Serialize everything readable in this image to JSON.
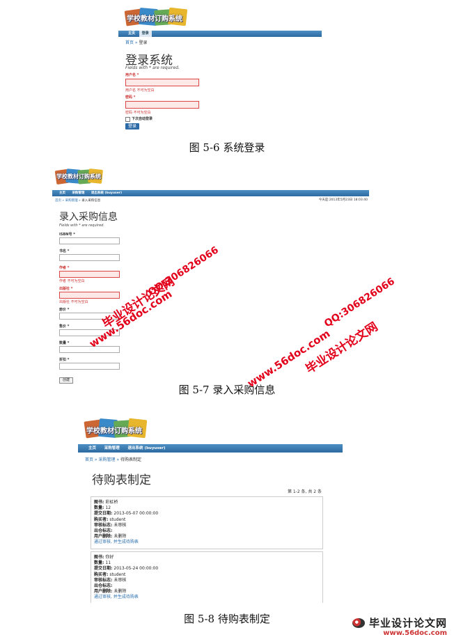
{
  "app_logo": "学校教材订购系统",
  "fig1": {
    "nav": [
      "主页",
      "登录"
    ],
    "breadcrumb": [
      "首页",
      "登录"
    ],
    "title": "登录系统",
    "required_note": "Fields with * are required.",
    "username_label": "用户名 *",
    "username_error": "用户名 不可为空白",
    "password_label": "密码 *",
    "password_error": "密码 不可为空白",
    "remember_label": "下次自动登录",
    "submit_label": "登录",
    "caption": "图 5-6 系统登录"
  },
  "fig2": {
    "nav": [
      "主页",
      "采购管理",
      "退出系统 (buyuser)"
    ],
    "breadcrumb": [
      "首页",
      "采购管理",
      "录入采购信息"
    ],
    "datetime": "今天是:2013年5月23日 18:03:40",
    "title": "录入采购信息",
    "required_note": "Fields with * are required.",
    "fields": [
      {
        "label": "ISBN号 *",
        "error": false,
        "msg": ""
      },
      {
        "label": "书名 *",
        "error": false,
        "msg": ""
      },
      {
        "label": "作者 *",
        "error": true,
        "msg": "作者 不可为空白"
      },
      {
        "label": "出版社 *",
        "error": true,
        "msg": "出版社 不可为空白"
      },
      {
        "label": "册价 *",
        "error": false,
        "msg": ""
      },
      {
        "label": "售价 *",
        "error": false,
        "msg": ""
      },
      {
        "label": "数量 *",
        "error": false,
        "msg": ""
      },
      {
        "label": "折扣 *",
        "error": false,
        "msg": ""
      }
    ],
    "submit_label": "创建",
    "caption": "图 5-7 录入采购信息"
  },
  "fig3": {
    "nav": [
      "主页",
      "采购管理",
      "退出系统 (buyuser)"
    ],
    "breadcrumb": [
      "首页",
      "采购管理",
      "待购表制定"
    ],
    "title": "待购表制定",
    "summary": "第 1-2 条, 共 2 条",
    "cards": [
      {
        "rows": [
          {
            "k": "图书:",
            "v": "彩虹桥"
          },
          {
            "k": "数量:",
            "v": "12"
          },
          {
            "k": "提交日期:",
            "v": "2013-05-07 00:00:00"
          },
          {
            "k": "购买者:",
            "v": "student"
          },
          {
            "k": "审核标志:",
            "v": "未审核"
          },
          {
            "k": "出仓标志:",
            "v": ""
          },
          {
            "k": "用户删除:",
            "v": "未删除"
          }
        ],
        "link": "通过审核, 并生成待购表"
      },
      {
        "rows": [
          {
            "k": "图书:",
            "v": "你好"
          },
          {
            "k": "数量:",
            "v": "11"
          },
          {
            "k": "提交日期:",
            "v": "2013-05-24 00:00:00"
          },
          {
            "k": "购买者:",
            "v": "student"
          },
          {
            "k": "审核标志:",
            "v": "未审核"
          },
          {
            "k": "出仓标志:",
            "v": ""
          },
          {
            "k": "用户删除:",
            "v": "未删除"
          }
        ],
        "link": "通过审核, 并生成待购表"
      }
    ],
    "caption": "图 5-8 待购表制定"
  },
  "watermarks": {
    "site": "www.56doc.com",
    "qq": "QQ:306826066",
    "brand": "毕业设计论文网"
  },
  "footer": {
    "brand": "毕业设计论文网",
    "site": "www.56doc.com"
  },
  "colors": {
    "nav_blue": "#2c6aa0",
    "link_blue": "#2a6fb0",
    "error_red": "#cc3333",
    "watermark_red": "#e3001b"
  }
}
